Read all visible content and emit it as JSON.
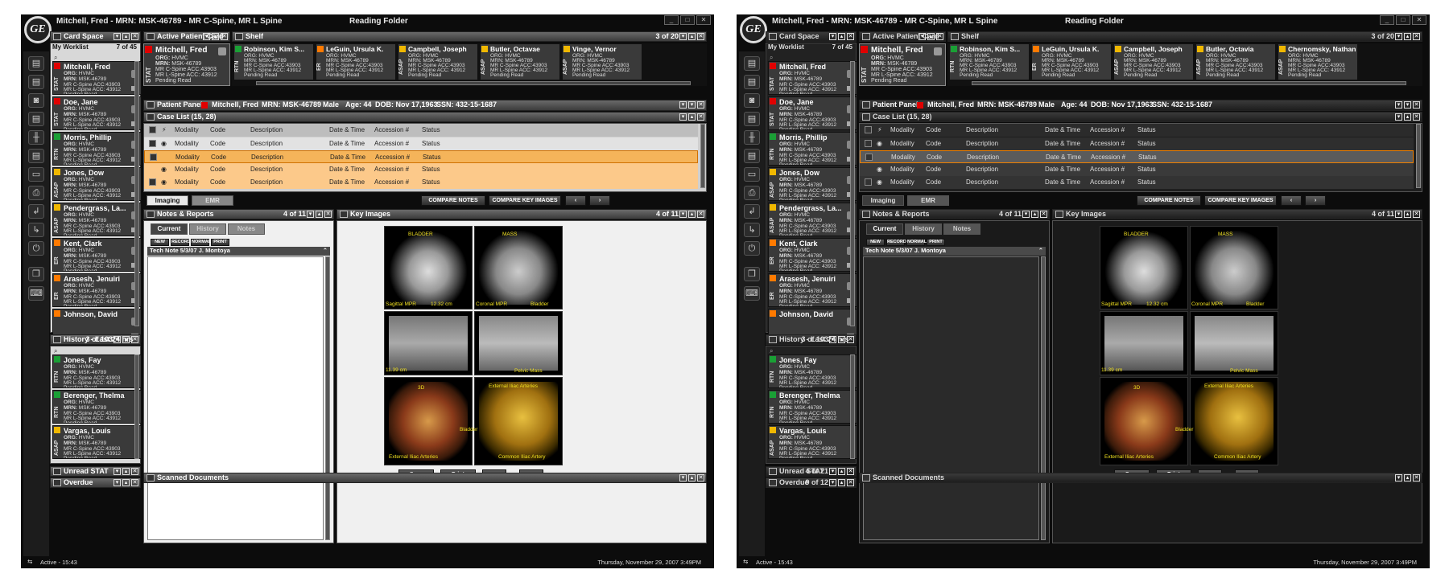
{
  "screens": [
    {
      "theme": "light",
      "title": "Mitchell, Fred - MRN: MSK-46789 - MR C-Spine, MR L Spine",
      "reading_folder": "Reading Folder",
      "logo": "GE",
      "card_space": {
        "title": "Card Space"
      },
      "worklist": {
        "title": "My Worklist",
        "count": "7 of 45",
        "items": [
          {
            "name": "Mitchell, Fred",
            "pri": "STAT",
            "color": "#e00000",
            "org": "ORG:",
            "orgv": "HVMC",
            "mrn": "MRN:",
            "mrnv": "MSK-46789",
            "l3": "MR C-Spine ACC:43903",
            "l4": "MR L-Spine ACC: 43912",
            "l5": "Pending Read"
          },
          {
            "name": "Doe, Jane",
            "pri": "STAT",
            "color": "#e00000",
            "org": "ORG:",
            "orgv": "HVMC",
            "mrn": "MRN:",
            "mrnv": "MSK-46789",
            "l3": "MR C-Spine ACC:43903",
            "l4": "MR L-Spine ACC: 43912",
            "l5": "Pending Read"
          },
          {
            "name": "Morris, Phillip",
            "pri": "RTN",
            "color": "#1aa035",
            "org": "ORG:",
            "orgv": "HVMC",
            "mrn": "MRN:",
            "mrnv": "MSK-46789",
            "l3": "MR C-Spine ACC:43903",
            "l4": "MR L-Spine ACC: 43912",
            "l5": "Pending Read"
          },
          {
            "name": "Jones, Dow",
            "pri": "ASAP",
            "color": "#f0b800",
            "org": "ORG:",
            "orgv": "HVMC",
            "mrn": "MRN:",
            "mrnv": "MSK-46789",
            "l3": "MR C-Spine ACC:43903",
            "l4": "MR L-Spine ACC: 43912",
            "l5": "Pending Read"
          },
          {
            "name": "Pendergrass, La...",
            "pri": "ASAP",
            "color": "#f0b800",
            "org": "ORG:",
            "orgv": "HVMC",
            "mrn": "MRN:",
            "mrnv": "MSK-46789",
            "l3": "MR C-Spine ACC:43903",
            "l4": "MR L-Spine ACC: 43912",
            "l5": "Pending Read"
          },
          {
            "name": "Kent, Clark",
            "pri": "ER",
            "color": "#ff7a00",
            "org": "ORG:",
            "orgv": "HVMC",
            "mrn": "MRN:",
            "mrnv": "MSK-46789",
            "l3": "MR C-Spine ACC:43903",
            "l4": "MR L-Spine ACC: 43912",
            "l5": "Pending Read"
          },
          {
            "name": "Arasesh, Jenuiri",
            "pri": "ER",
            "color": "#ff7a00",
            "org": "ORG:",
            "orgv": "HVMC",
            "mrn": "MRN:",
            "mrnv": "MSK-46789",
            "l3": "MR C-Spine ACC:43903",
            "l4": "MR L-Spine ACC: 43912",
            "l5": "Pending Read"
          },
          {
            "name": "Johnson, David",
            "pri": "",
            "color": "#ff7a00",
            "org": "",
            "orgv": "",
            "mrn": "",
            "mrnv": "",
            "l3": "",
            "l4": "",
            "l5": ""
          }
        ]
      },
      "history": {
        "title": "History - Last 24 hrs",
        "count": "3 of 103",
        "items": [
          {
            "name": "Jones, Fay",
            "pri": "RTN",
            "color": "#1aa035",
            "org": "ORG:",
            "orgv": "HVMC",
            "mrn": "MRN:",
            "mrnv": "MSK-46789",
            "l3": "MR C-Spine ACC:43903",
            "l4": "MR L-Spine ACC: 43912",
            "l5": "Pending Read"
          },
          {
            "name": "Berenger, Thelma",
            "pri": "RTN",
            "color": "#1aa035",
            "org": "ORG:",
            "orgv": "HVMC",
            "mrn": "MRN:",
            "mrnv": "MSK-46789",
            "l3": "MR C-Spine ACC:43903",
            "l4": "MR L-Spine ACC: 43912",
            "l5": "Pending Read"
          },
          {
            "name": "Vargas, Louis",
            "pri": "ASAP",
            "color": "#f0b800",
            "org": "ORG:",
            "orgv": "HVMC",
            "mrn": "MRN:",
            "mrnv": "MSK-46789",
            "l3": "MR C-Spine ACC:43903",
            "l4": "MR L-Spine ACC: 43912",
            "l5": "Pending Read"
          }
        ]
      },
      "unread_stat": {
        "title": "Unread STAT",
        "count": ""
      },
      "overdue": {
        "title": "Overdue",
        "count": ""
      },
      "active_card": {
        "title": "Active Patient Card",
        "name": "Mitchell, Fred",
        "pri": "STAT",
        "org": "ORG:",
        "orgv": "HVMC",
        "mrn": "MRN:",
        "mrnv": "MSK-46789",
        "l3": "MR C-Spine ACC:43903",
        "l4": "MR L-Spine ACC: 43912",
        "l5": "Pending Read"
      },
      "shelf": {
        "title": "Shelf",
        "count": "3 of 20",
        "cards": [
          {
            "name": "Robinson, Kim S...",
            "pri": "RTN",
            "color": "#1aa035",
            "l1": "ORG: HVMC",
            "l2": "MRN: MSK-46789",
            "l3": "MR C-Spine ACC:43903",
            "l4": "MR L-Spine ACC: 43912",
            "l5": "Pending Read"
          },
          {
            "name": "LeGuin, Ursula K.",
            "pri": "ER",
            "color": "#ff7a00",
            "l1": "ORG: HVMC",
            "l2": "MRN: MSK-46789",
            "l3": "MR C-Spine ACC:43903",
            "l4": "MR L-Spine ACC: 43912",
            "l5": "Pending Read"
          },
          {
            "name": "Campbell, Joseph",
            "pri": "ASAP",
            "color": "#f0b800",
            "l1": "ORG: HVMC",
            "l2": "MRN: MSK-46789",
            "l3": "MR C-Spine ACC:43903",
            "l4": "MR L-Spine ACC: 43912",
            "l5": "Pending Read"
          },
          {
            "name": "Butler, Octavae",
            "pri": "ASAP",
            "color": "#f0b800",
            "l1": "ORG: HVMC",
            "l2": "MRN: MSK-46789",
            "l3": "MR C-Spine ACC:43903",
            "l4": "MR L-Spine ACC: 43912",
            "l5": "Pending Read"
          },
          {
            "name": "Vinge, Vernor",
            "pri": "ASAP",
            "color": "#f0b800",
            "l1": "ORG: HVMC",
            "l2": "MRN: MSK-46789",
            "l3": "MR C-Spine ACC:43903",
            "l4": "MR L-Spine ACC: 43912",
            "l5": "Pending Read"
          }
        ]
      },
      "patient_panel": {
        "title": "Patient Panel",
        "name": "Mitchell, Fred",
        "mrn": "MRN: MSK-46789",
        "sex": "Male",
        "age": "Age: 44",
        "dob": "DOB: Nov 17,1963",
        "ssn": "SSN: 432-15-1687"
      },
      "case_list": {
        "title": "Case List (15, 28)",
        "headers": [
          "Modality",
          "Code",
          "Description",
          "Date & Time",
          "Accession #",
          "Status"
        ],
        "rows": [
          [
            "Modality",
            "Code",
            "Description",
            "Date & Time",
            "Accession #",
            "Status"
          ],
          [
            "Modality",
            "Code",
            "Description",
            "Date & Time",
            "Accession #",
            "Status"
          ],
          [
            "Modality",
            "Code",
            "Description",
            "Date & Time",
            "Accession #",
            "Status"
          ],
          [
            "Modality",
            "Code",
            "Description",
            "Date & Time",
            "Accession #",
            "Status"
          ]
        ]
      },
      "tabs": {
        "imaging": "Imaging",
        "emr": "EMR",
        "compare_notes": "COMPARE NOTES",
        "compare_key": "COMPARE KEY IMAGES"
      },
      "notes": {
        "title": "Notes & Reports",
        "count": "4 of 11",
        "tabs": [
          "Current",
          "History",
          "Notes"
        ],
        "buttons": [
          "NEW",
          "RECORD",
          "NORMAL",
          "PRINT"
        ],
        "note_title": "Tech Note",
        "note_date": "5/3/07",
        "note_author": "J. Montoya"
      },
      "key_images": {
        "title": "Key Images",
        "count": "4 of 11",
        "save": "Save",
        "print": "Print",
        "labels": [
          "BLADDER",
          "MASS",
          "Sagittal MPR",
          "Coronal MPR",
          "Bladder",
          "Pelvic Mass",
          "3D",
          "External Iliac Arteries",
          "Bladder",
          "External Iliac Arteries",
          "Common Iliac Artery",
          "12.32 cm",
          "11.39 cm"
        ]
      },
      "scanned": {
        "title": "Scanned Documents"
      },
      "status": {
        "active": "Active - 15:43",
        "datetime": "Thursday, November 29, 2007  3:49PM"
      }
    },
    {
      "theme": "dark",
      "title": "Mitchell, Fred - MRN: MSK-46789 - MR C-Spine, MR L Spine",
      "reading_folder": "Reading Folder",
      "logo": "GE",
      "card_space": {
        "title": "Card Space"
      },
      "worklist": {
        "title": "My Worklist",
        "count": "7 of 45",
        "items": [
          {
            "name": "Mitchell, Fred",
            "pri": "STAT",
            "color": "#e00000",
            "org": "ORG:",
            "orgv": "HVMC",
            "mrn": "MRN:",
            "mrnv": "MSK-46789",
            "l3": "MR C-Spine ACC:43903",
            "l4": "MR L-Spine ACC: 43912",
            "l5": "Pending Read"
          },
          {
            "name": "Doe, Jane",
            "pri": "STAT",
            "color": "#e00000",
            "org": "ORG:",
            "orgv": "HVMC",
            "mrn": "MRN:",
            "mrnv": "MSK-46789",
            "l3": "MR C-Spine ACC:43903",
            "l4": "MR L-Spine ACC: 43912",
            "l5": "Pending Read"
          },
          {
            "name": "Morris, Phillip",
            "pri": "RTN",
            "color": "#1aa035",
            "org": "ORG:",
            "orgv": "HVMC",
            "mrn": "MRN:",
            "mrnv": "MSK-46789",
            "l3": "MR C-Spine ACC:43903",
            "l4": "MR L-Spine ACC: 43912",
            "l5": "Pending Read"
          },
          {
            "name": "Jones, Dow",
            "pri": "ASAP",
            "color": "#f0b800",
            "org": "ORG:",
            "orgv": "HVMC",
            "mrn": "MRN:",
            "mrnv": "MSK-46789",
            "l3": "MR C-Spine ACC:43903",
            "l4": "MR L-Spine ACC: 43912",
            "l5": "Pending Read"
          },
          {
            "name": "Pendergrass, La...",
            "pri": "ASAP",
            "color": "#f0b800",
            "org": "ORG:",
            "orgv": "HVMC",
            "mrn": "MRN:",
            "mrnv": "MSK-46789",
            "l3": "MR C-Spine ACC:43903",
            "l4": "MR L-Spine ACC: 43912",
            "l5": "Pending Read"
          },
          {
            "name": "Kent, Clark",
            "pri": "ER",
            "color": "#ff7a00",
            "org": "ORG:",
            "orgv": "HVMC",
            "mrn": "MRN:",
            "mrnv": "MSK-46789",
            "l3": "MR C-Spine ACC:43903",
            "l4": "MR L-Spine ACC: 43912",
            "l5": "Pending Read"
          },
          {
            "name": "Arasesh, Jenuiri",
            "pri": "ER",
            "color": "#ff7a00",
            "org": "ORG:",
            "orgv": "HVMC",
            "mrn": "MRN:",
            "mrnv": "MSK-46789",
            "l3": "MR C-Spine ACC:43903",
            "l4": "MR L-Spine ACC: 43912",
            "l5": "Pending Read"
          },
          {
            "name": "Johnson, David",
            "pri": "",
            "color": "#ff7a00",
            "org": "",
            "orgv": "",
            "mrn": "",
            "mrnv": "",
            "l3": "",
            "l4": "",
            "l5": ""
          }
        ]
      },
      "history": {
        "title": "History - Last 24 hrs",
        "count": "3 of 103",
        "items": [
          {
            "name": "Jones, Fay",
            "pri": "RTN",
            "color": "#1aa035",
            "org": "ORG:",
            "orgv": "HVMC",
            "mrn": "MRN:",
            "mrnv": "MSK-46789",
            "l3": "MR C-Spine ACC:43903",
            "l4": "MR L-Spine ACC: 43912",
            "l5": "Pending Read"
          },
          {
            "name": "Berenger, Thelma",
            "pri": "RTN",
            "color": "#1aa035",
            "org": "ORG:",
            "orgv": "HVMC",
            "mrn": "MRN:",
            "mrnv": "MSK-46789",
            "l3": "MR C-Spine ACC:43903",
            "l4": "MR L-Spine ACC: 43912",
            "l5": "Pending Read"
          },
          {
            "name": "Vargas, Louis",
            "pri": "ASAP",
            "color": "#f0b800",
            "org": "ORG:",
            "orgv": "HVMC",
            "mrn": "MRN:",
            "mrnv": "MSK-46789",
            "l3": "MR C-Spine ACC:43903",
            "l4": "MR L-Spine ACC: 43912",
            "l5": "Pending Read"
          }
        ]
      },
      "unread_stat": {
        "title": "Unread STAT",
        "count": "4 of 21"
      },
      "overdue": {
        "title": "Overdue",
        "count": "9 of 12"
      },
      "active_card": {
        "title": "Active Patient Card",
        "name": "Mitchell, Fred",
        "pri": "STAT",
        "org": "ORG:",
        "orgv": "HVMC",
        "mrn": "MRN:",
        "mrnv": "MSK-46789",
        "l3": "MR C-Spine ACC:43903",
        "l4": "MR L-Spine ACC: 43912",
        "l5": "Pending Read"
      },
      "shelf": {
        "title": "Shelf",
        "count": "3 of 20",
        "cards": [
          {
            "name": "Robinson, Kim S...",
            "pri": "RTN",
            "color": "#1aa035",
            "l1": "ORG: HVMC",
            "l2": "MRN: MSK-46789",
            "l3": "MR C-Spine ACC:43903",
            "l4": "MR L-Spine ACC: 43912",
            "l5": "Pending Read"
          },
          {
            "name": "LeGuin, Ursula K.",
            "pri": "ER",
            "color": "#ff7a00",
            "l1": "ORG: HVMC",
            "l2": "MRN: MSK-46789",
            "l3": "MR C-Spine ACC:43903",
            "l4": "MR L-Spine ACC: 43912",
            "l5": "Pending Read"
          },
          {
            "name": "Campbell, Joseph",
            "pri": "ASAP",
            "color": "#f0b800",
            "l1": "ORG: HVMC",
            "l2": "MRN: MSK-46789",
            "l3": "MR C-Spine ACC:43903",
            "l4": "MR L-Spine ACC: 43912",
            "l5": "Pending Read"
          },
          {
            "name": "Butler, Octavia",
            "pri": "ASAP",
            "color": "#f0b800",
            "l1": "ORG: HVMC",
            "l2": "MRN: MSK-46789",
            "l3": "MR C-Spine ACC:43903",
            "l4": "MR L-Spine ACC: 43912",
            "l5": "Pending Read"
          },
          {
            "name": "Chernomsky, Nathan",
            "pri": "ASAP",
            "color": "#f0b800",
            "l1": "ORG: HVMC",
            "l2": "MRN: MSK-46789",
            "l3": "MR C-Spine ACC:43903",
            "l4": "MR L-Spine ACC: 43912",
            "l5": "Pending Read"
          }
        ]
      },
      "patient_panel": {
        "title": "Patient Panel",
        "name": "Mitchell, Fred",
        "mrn": "MRN: MSK-46789",
        "sex": "Male",
        "age": "Age: 44",
        "dob": "DOB: Nov 17,1963",
        "ssn": "SSN: 432-15-1687"
      },
      "case_list": {
        "title": "Case List (15, 28)",
        "headers": [
          "Modality",
          "Code",
          "Description",
          "Date & Time",
          "Accession #",
          "Status"
        ],
        "rows": [
          [
            "Modality",
            "Code",
            "Description",
            "Date & Time",
            "Accession #",
            "Status"
          ],
          [
            "Modality",
            "Code",
            "Description",
            "Date & Time",
            "Accession #",
            "Status"
          ],
          [
            "Modality",
            "Code",
            "Description",
            "Date & Time",
            "Accession #",
            "Status"
          ],
          [
            "Modality",
            "Code",
            "Description",
            "Date & Time",
            "Accession #",
            "Status"
          ]
        ]
      },
      "tabs": {
        "imaging": "Imaging",
        "emr": "EMR",
        "compare_notes": "COMPARE NOTES",
        "compare_key": "COMPARE KEY IMAGES"
      },
      "notes": {
        "title": "Notes & Reports",
        "count": "4 of 11",
        "tabs": [
          "Current",
          "History",
          "Notes"
        ],
        "buttons": [
          "NEW",
          "RECORD",
          "NORMAL",
          "PRINT"
        ],
        "note_title": "Tech Note",
        "note_date": "5/3/07",
        "note_author": "J. Montoya"
      },
      "key_images": {
        "title": "Key Images",
        "count": "4 of 11",
        "save": "Save",
        "print": "Print",
        "labels": [
          "BLADDER",
          "MASS",
          "Sagittal MPR",
          "Coronal MPR",
          "Bladder",
          "Pelvic Mass",
          "3D",
          "External Iliac Arteries",
          "Bladder",
          "External Iliac Arteries",
          "Common Iliac Artery",
          "12.32 cm",
          "11.39 cm"
        ]
      },
      "scanned": {
        "title": "Scanned Documents"
      },
      "status": {
        "active": "Active - 15:43",
        "datetime": "Thursday, November 29, 2007  3:49PM"
      }
    }
  ]
}
